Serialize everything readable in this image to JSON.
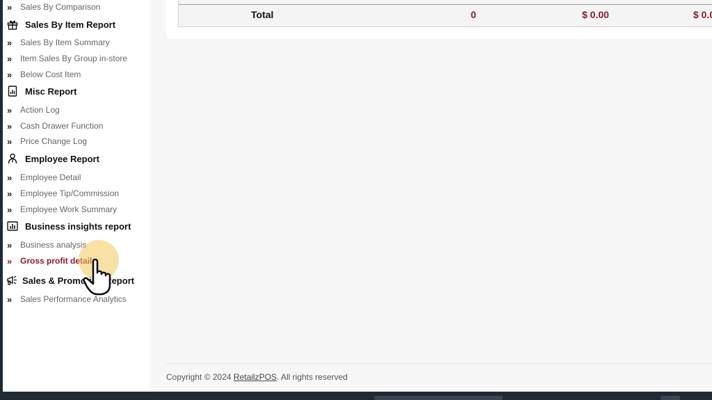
{
  "sidebar": {
    "top_item": "Sales By Comparison",
    "sections": [
      {
        "title": "Sales By Item Report",
        "icon": "gift-icon",
        "items": [
          "Sales By Item Summary",
          "Item Sales By Group in-store",
          "Below Cost Item"
        ]
      },
      {
        "title": "Misc Report",
        "icon": "report-doc-icon",
        "items": [
          "Action Log",
          "Cash Drawer Function",
          "Price Change Log"
        ]
      },
      {
        "title": "Employee Report",
        "icon": "employee-icon",
        "items": [
          "Employee Detail",
          "Employee Tip/Commission",
          "Employee Work Summary"
        ]
      },
      {
        "title": "Business insights report",
        "icon": "bar-chart-icon",
        "items": [
          "Business analysis",
          "Gross profit details"
        ]
      },
      {
        "title": "Sales & Promotion Report",
        "icon": "megaphone-icon",
        "items": [
          "Sales Performance Analytics"
        ]
      }
    ],
    "active_item": "Gross profit details",
    "item_chevron": "»"
  },
  "table": {
    "total_label": "Total",
    "total_qty": "0",
    "total_amount_1": "$ 0.00",
    "total_amount_2": "$ 0.0"
  },
  "footer": {
    "prefix": "Copyright © 2024 ",
    "link": "RetailzPOS",
    "suffix": ". All rights reserved"
  },
  "colors": {
    "accent": "#8b1a2b",
    "cursor_highlight": "#f0c85a"
  }
}
